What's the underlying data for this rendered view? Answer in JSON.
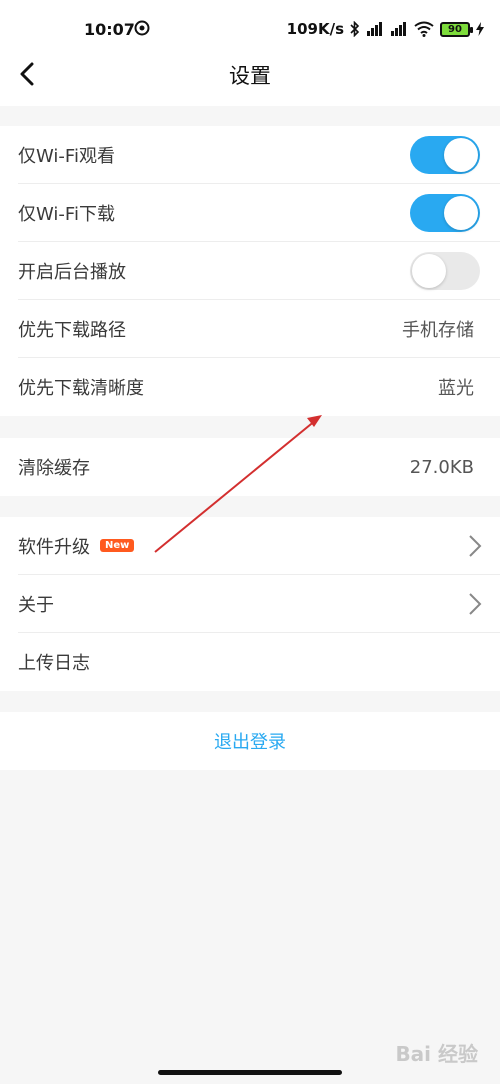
{
  "status": {
    "time": "10:07",
    "speed": "109K/s",
    "battery": "90"
  },
  "header": {
    "title": "设置"
  },
  "groups": [
    {
      "rows": [
        {
          "label": "仅Wi-Fi观看",
          "toggle": "on"
        },
        {
          "label": "仅Wi-Fi下载",
          "toggle": "on"
        },
        {
          "label": "开启后台播放",
          "toggle": "off"
        },
        {
          "label": "优先下载路径",
          "value": "手机存储"
        },
        {
          "label": "优先下载清晰度",
          "value": "蓝光"
        }
      ]
    },
    {
      "rows": [
        {
          "label": "清除缓存",
          "value": "27.0KB"
        }
      ]
    },
    {
      "rows": [
        {
          "label": "软件升级",
          "badge": "New"
        },
        {
          "label": "关于"
        },
        {
          "label": "上传日志"
        }
      ]
    }
  ],
  "logout_label": "退出登录",
  "watermark": "Bai 经验",
  "colors": {
    "accent": "#29a9f1",
    "badge": "#ff5a1f",
    "annotation_arrow": "#d32f2f"
  }
}
